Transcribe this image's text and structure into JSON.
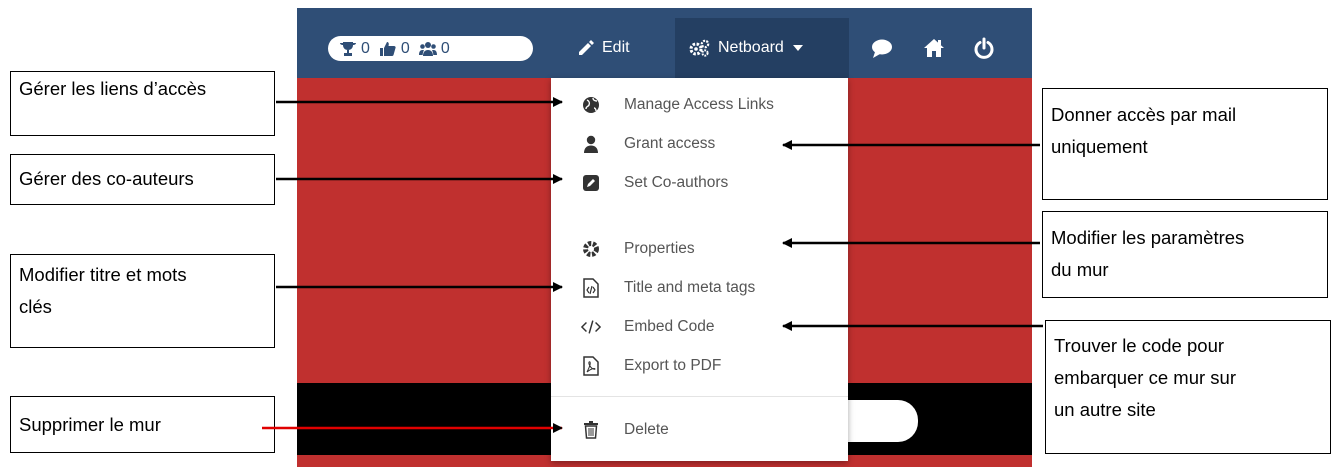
{
  "toolbar": {
    "stats": {
      "trophies": "0",
      "likes": "0",
      "members": "0"
    },
    "edit_label": "Edit",
    "netboard_label": "Netboard",
    "icons": [
      "comment-icon",
      "home-icon",
      "power-icon"
    ]
  },
  "menu": {
    "items": [
      {
        "label": "Manage Access Links",
        "icon": "globe-icon"
      },
      {
        "label": "Grant access",
        "icon": "user-icon"
      },
      {
        "label": "Set Co-authors",
        "icon": "edit-square-icon"
      },
      {
        "label": "Properties",
        "icon": "gear-icon"
      },
      {
        "label": "Title and meta tags",
        "icon": "file-code-icon"
      },
      {
        "label": "Embed Code",
        "icon": "code-icon"
      },
      {
        "label": "Export to PDF",
        "icon": "file-pdf-icon"
      },
      {
        "label": "Delete",
        "icon": "trash-icon"
      }
    ]
  },
  "callouts": {
    "manage_links": "Gérer les liens d’accès",
    "coauthors": "Gérer des co-auteurs",
    "title_tags_1": "Modifier titre et mots",
    "title_tags_2": "clés",
    "delete": "Supprimer le mur",
    "grant_1": "Donner accès par mail",
    "grant_2": "uniquement",
    "properties_1": "Modifier les paramètres",
    "properties_2": "du mur",
    "embed_1": "Trouver le code pour",
    "embed_2": "embarquer ce mur sur",
    "embed_3": "un autre site"
  },
  "colors": {
    "navbar": "#2f4e76",
    "navbar_active": "#243f62",
    "board_red": "#c0302f",
    "arrow_black": "#000000",
    "arrow_red": "#e00000"
  }
}
